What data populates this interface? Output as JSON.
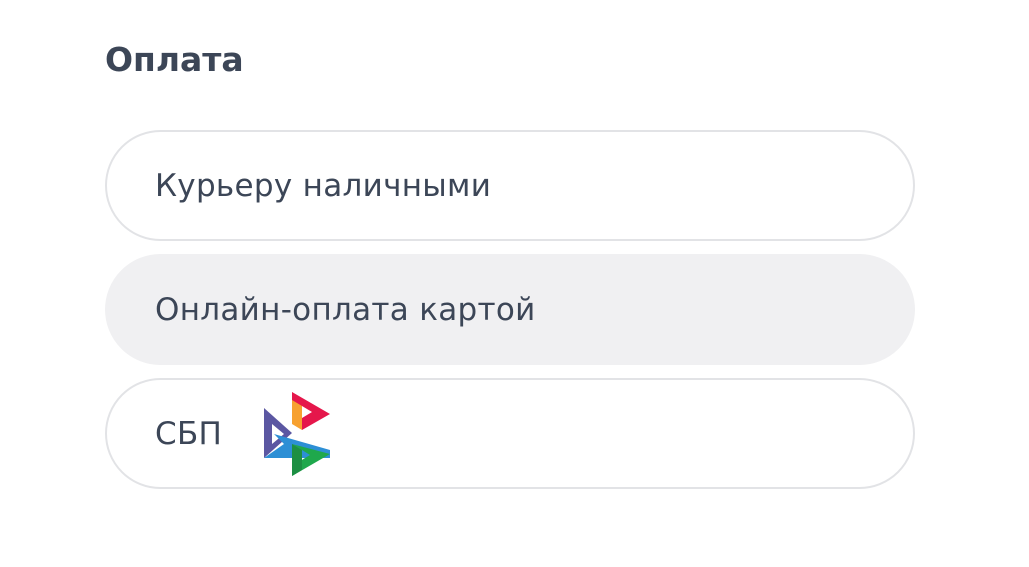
{
  "payment": {
    "title": "Оплата",
    "options": [
      {
        "label": "Курьеру наличными",
        "selected": false
      },
      {
        "label": "Онлайн-оплата картой",
        "selected": true
      },
      {
        "label": "СБП",
        "selected": false,
        "icon": "sbp-logo-icon"
      }
    ]
  },
  "colors": {
    "text": "#3c4657",
    "selected_background": "#f0f0f2",
    "border": "#e2e3e6",
    "sbp_purple": "#5b57a2",
    "sbp_orange": "#f7a130",
    "sbp_red": "#e5174b",
    "sbp_green": "#1fa84c",
    "sbp_blue": "#2d8fd5"
  }
}
